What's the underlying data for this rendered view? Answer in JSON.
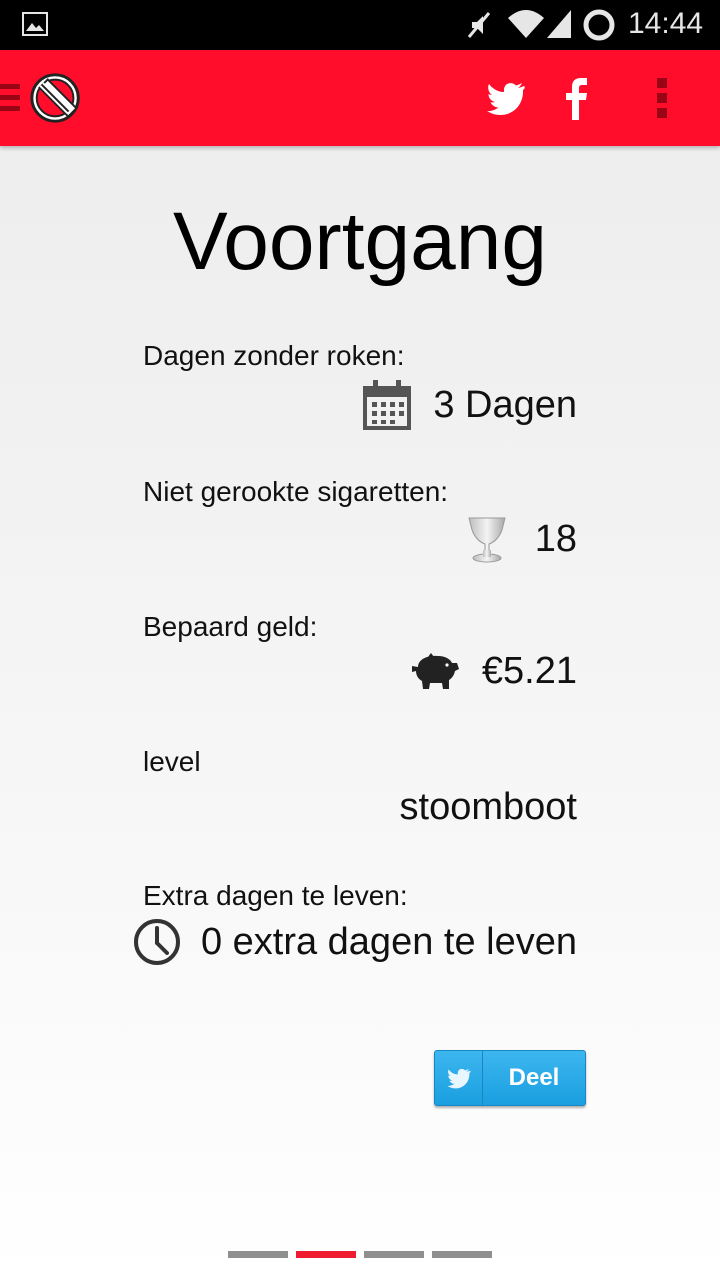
{
  "status_bar": {
    "time": "14:44",
    "icons": [
      "gallery-notification-icon",
      "mute-icon",
      "wifi-icon",
      "signal-icon",
      "battery-icon"
    ]
  },
  "action_bar": {
    "background": "#ff0d2b",
    "icons": [
      "drawer-icon",
      "no-smoking-logo",
      "twitter-icon",
      "facebook-icon",
      "overflow-menu-icon"
    ]
  },
  "page": {
    "title": "Voortgang"
  },
  "stats": {
    "days": {
      "label": "Dagen zonder roken:",
      "value": "3 Dagen",
      "icon": "calendar-icon"
    },
    "cigarettes": {
      "label": "Niet gerookte sigaretten:",
      "value": "18",
      "icon": "trophy-icon"
    },
    "money": {
      "label": "Bepaard geld:",
      "value": "€5.21",
      "icon": "piggy-bank-icon"
    },
    "level": {
      "label": "level",
      "value": "stoomboot"
    },
    "extra_days": {
      "label": "Extra dagen te leven:",
      "value": "0 extra dagen te leven",
      "icon": "clock-icon"
    }
  },
  "share": {
    "label": "Deel",
    "icon": "twitter-bird-icon",
    "color": "#2aa9e8"
  },
  "pager": {
    "page_count": 4,
    "active_page": 2,
    "active_color": "#ee1c2e"
  }
}
